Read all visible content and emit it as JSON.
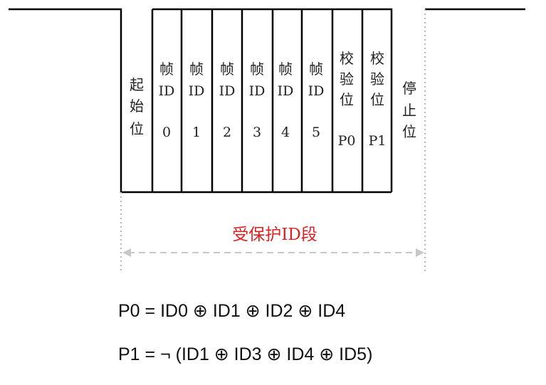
{
  "fields": [
    {
      "lines": [
        "起",
        "始",
        "位"
      ]
    },
    {
      "lines": [
        "帧",
        "ID",
        "0"
      ]
    },
    {
      "lines": [
        "帧",
        "ID",
        "1"
      ]
    },
    {
      "lines": [
        "帧",
        "ID",
        "2"
      ]
    },
    {
      "lines": [
        "帧",
        "ID",
        "3"
      ]
    },
    {
      "lines": [
        "帧",
        "ID",
        "4"
      ]
    },
    {
      "lines": [
        "帧",
        "ID",
        "5"
      ]
    },
    {
      "lines": [
        "校",
        "验",
        "位",
        "P0"
      ]
    },
    {
      "lines": [
        "校",
        "验",
        "位",
        "P1"
      ]
    },
    {
      "lines": [
        "停",
        "止",
        "位"
      ]
    }
  ],
  "protected_label": "受保护ID段",
  "formulas": {
    "p0": "P0 = ID0 ⊕ ID1 ⊕ ID2 ⊕ ID4",
    "p1": "P1 = ¬ (ID1 ⊕ ID3 ⊕ ID4 ⊕ ID5)"
  },
  "colors": {
    "signal": "#000000",
    "dotted_guides": "#bbbbbb",
    "arrow": "#c8c8c8",
    "label_red": "#e02020"
  }
}
